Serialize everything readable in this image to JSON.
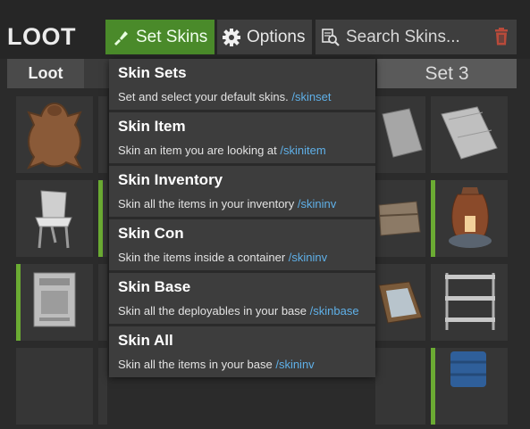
{
  "header": {
    "title": "LOOT",
    "set_skins_label": "Set Skins",
    "options_label": "Options",
    "search_placeholder": "Search Skins...",
    "accent_color": "#4a8a2a",
    "trash_color": "#b94a3a"
  },
  "tabs": {
    "loot_label": "Loot",
    "set3_label": "Set 3"
  },
  "menu": {
    "items": [
      {
        "title": "Skin Sets",
        "desc": "Set and select your default skins.",
        "cmd": "/skinset"
      },
      {
        "title": "Skin Item",
        "desc": "Skin an item you are looking at",
        "cmd": "/skinitem"
      },
      {
        "title": "Skin Inventory",
        "desc": "Skin all the items in your inventory",
        "cmd": "/skininv"
      },
      {
        "title": "Skin Con",
        "desc": "Skin the items inside a container",
        "cmd": "/skininv"
      },
      {
        "title": "Skin Base",
        "desc": "Skin all the deployables in your base",
        "cmd": "/skinbase"
      },
      {
        "title": "Skin All",
        "desc": "Skin all the items in your base",
        "cmd": "/skininv"
      }
    ]
  },
  "grid": {
    "items": [
      {
        "icon": "bear-rug-icon"
      },
      {
        "icon": "chair-icon"
      },
      {
        "icon": "wanted-poster-icon"
      },
      {
        "icon": "sheet-metal-icon"
      },
      {
        "icon": "large-box-icon"
      },
      {
        "icon": "furnace-icon"
      },
      {
        "icon": "picture-frame-icon"
      },
      {
        "icon": "shelves-icon"
      },
      {
        "icon": "barrel-icon"
      }
    ]
  }
}
